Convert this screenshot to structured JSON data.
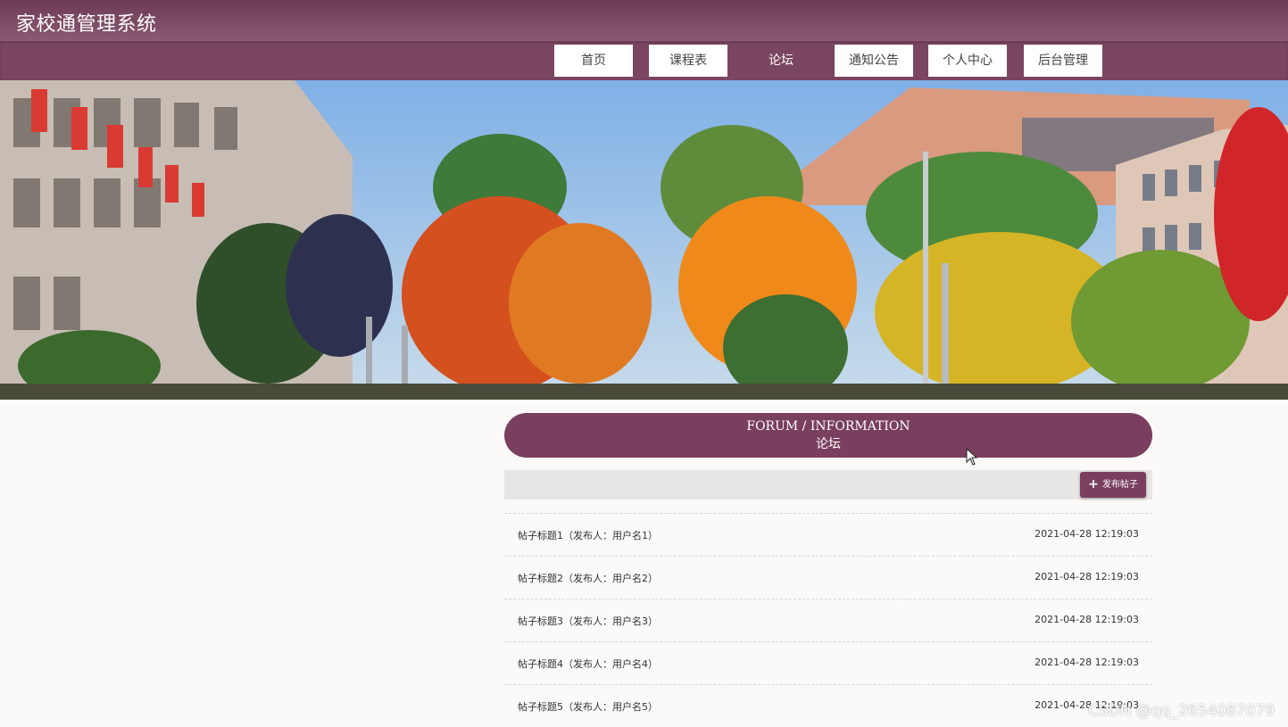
{
  "app": {
    "title": "家校通管理系统"
  },
  "nav": {
    "items": [
      {
        "label": "首页",
        "active": false
      },
      {
        "label": "课程表",
        "active": false
      },
      {
        "label": "论坛",
        "active": true
      },
      {
        "label": "通知公告",
        "active": false
      },
      {
        "label": "个人中心",
        "active": false
      },
      {
        "label": "后台管理",
        "active": false
      }
    ]
  },
  "forum": {
    "title_en": "FORUM / INFORMATION",
    "title_cn": "论坛",
    "publish_label": "发布帖子",
    "publish_icon": "plus-icon"
  },
  "posts": [
    {
      "title": "帖子标题1（发布人：用户名1）",
      "time": "2021-04-28 12:19:03"
    },
    {
      "title": "帖子标题2（发布人：用户名2）",
      "time": "2021-04-28 12:19:03"
    },
    {
      "title": "帖子标题3（发布人：用户名3）",
      "time": "2021-04-28 12:19:03"
    },
    {
      "title": "帖子标题4（发布人：用户名4）",
      "time": "2021-04-28 12:19:03"
    },
    {
      "title": "帖子标题5（发布人：用户名5）",
      "time": "2021-04-28 12:19:03"
    }
  ],
  "watermark": "CSDN @qq_2654087079",
  "colors": {
    "primary": "#7a3f5e",
    "title_bar": "#8a5a72",
    "nav_bar": "#7a4560"
  }
}
